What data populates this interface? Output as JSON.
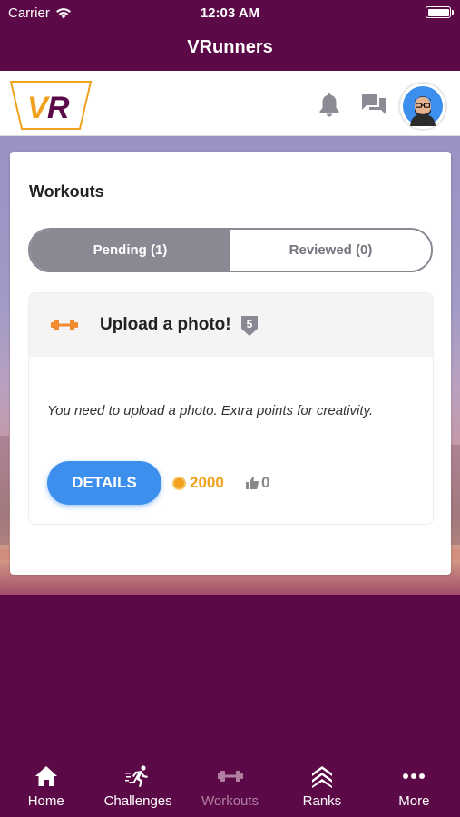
{
  "status_bar": {
    "carrier": "Carrier",
    "time": "12:03 AM"
  },
  "title_bar": {
    "title": "VRunners"
  },
  "header": {
    "logo_text": "VR",
    "icons": [
      "bell-icon",
      "chat-icon",
      "avatar"
    ]
  },
  "workouts": {
    "title": "Workouts",
    "tabs": [
      {
        "label": "Pending (1)",
        "active": true
      },
      {
        "label": "Reviewed (0)",
        "active": false
      }
    ],
    "items": [
      {
        "title": "Upload a photo!",
        "level": "5",
        "description": "You need to upload a photo. Extra points for creativity.",
        "details_label": "DETAILS",
        "points": "2000",
        "likes": "0"
      }
    ]
  },
  "tab_bar": {
    "items": [
      {
        "label": "Home",
        "icon": "home-icon"
      },
      {
        "label": "Challenges",
        "icon": "running-icon"
      },
      {
        "label": "Workouts",
        "icon": "dumbbell-icon",
        "current": true
      },
      {
        "label": "Ranks",
        "icon": "ranks-chevron-icon"
      },
      {
        "label": "More",
        "icon": "more-dots-icon"
      }
    ]
  },
  "colors": {
    "brand": "#5c0a47",
    "accent_blue": "#3d8fee",
    "points_orange": "#f0a21e",
    "segment_gray": "#8b8894"
  }
}
